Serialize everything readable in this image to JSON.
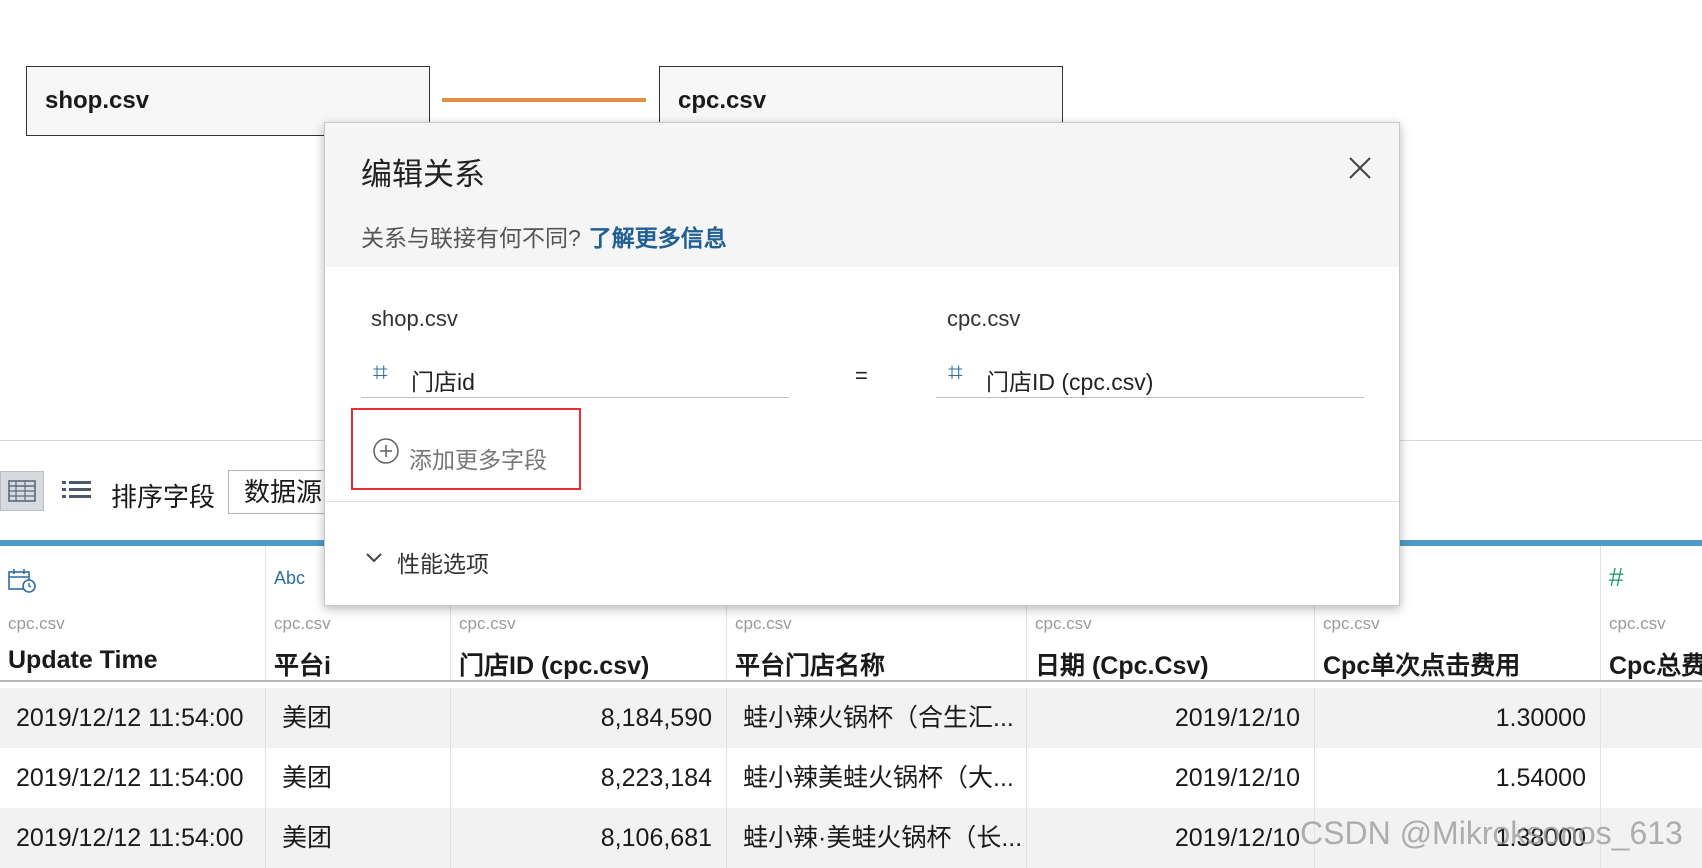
{
  "canvas": {
    "left_table": "shop.csv",
    "right_table": "cpc.csv",
    "relation_color": "#e38f3f"
  },
  "toolbar": {
    "sort_label": "排序字段",
    "sort_value": "数据源"
  },
  "dialog": {
    "title": "编辑关系",
    "subtitle": "关系与联接有何不同?",
    "learn_more": "了解更多信息",
    "left_source": "shop.csv",
    "right_source": "cpc.csv",
    "left_field": "门店id",
    "right_field": "门店ID (cpc.csv)",
    "operator": "=",
    "add_field": "添加更多字段",
    "performance": "性能选项"
  },
  "grid": {
    "accent_color": "#4d9bc9",
    "columns": [
      {
        "type_icon": "calendar-clock-icon",
        "source": "cpc.csv",
        "name": "Update Time"
      },
      {
        "type_icon": "Abc",
        "source": "cpc.csv",
        "name": "平台i"
      },
      {
        "type_icon": "",
        "source": "cpc.csv",
        "name": "门店ID (cpc.csv)"
      },
      {
        "type_icon": "",
        "source": "cpc.csv",
        "name": "平台门店名称"
      },
      {
        "type_icon": "",
        "source": "cpc.csv",
        "name": "日期 (Cpc.Csv)"
      },
      {
        "type_icon": "",
        "source": "cpc.csv",
        "name": "Cpc单次点击费用"
      },
      {
        "type_icon": "#",
        "source": "cpc.csv",
        "name": "Cpc总费"
      }
    ],
    "rows": [
      [
        "2019/12/12 11:54:00",
        "美团",
        "8,184,590",
        "蛙小辣火锅杯（合生汇...",
        "2019/12/10",
        "1.30000",
        ""
      ],
      [
        "2019/12/12 11:54:00",
        "美团",
        "8,223,184",
        "蛙小辣美蛙火锅杯（大...",
        "2019/12/10",
        "1.54000",
        ""
      ],
      [
        "2019/12/12 11:54:00",
        "美团",
        "8,106,681",
        "蛙小辣·美蛙火锅杯（长...",
        "2019/12/10",
        "1.38000",
        ""
      ]
    ]
  },
  "watermark": "CSDN @Mikroksonos_613"
}
